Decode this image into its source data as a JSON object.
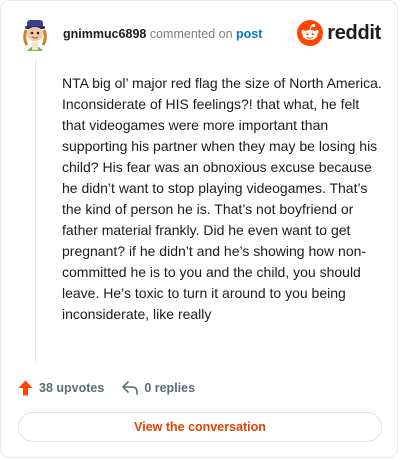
{
  "header": {
    "username": "gnimmuc6898",
    "commented_text": "commented on",
    "post_link": "post",
    "brand": "reddit"
  },
  "comment": {
    "body": "NTA big ol’ major red flag the size of North America. Inconsiderate of HIS feelings?! that what, he felt that videogames were more important than supporting his partner when they may be losing his child? His fear was an obnoxious excuse because he didn’t want to stop playing videogames. That’s the kind of person he is. That’s not boyfriend or father material frankly. Did he even want to get pregnant? if he didn’t and he’s showing how non-committed he is to you and the child, you should leave. He’s toxic to turn it around to you being inconsiderate, like really"
  },
  "footer": {
    "upvotes": "38 upvotes",
    "replies": "0 replies",
    "cta_label": "View the conversation"
  },
  "colors": {
    "brand_orange": "#ff4500",
    "upvote_orange": "#ff4500",
    "link_blue": "#0079d3",
    "cta_text": "#e34201"
  },
  "icons": [
    "avatar",
    "reddit-snoo-icon",
    "upvote-arrow-icon",
    "reply-arrow-icon"
  ]
}
